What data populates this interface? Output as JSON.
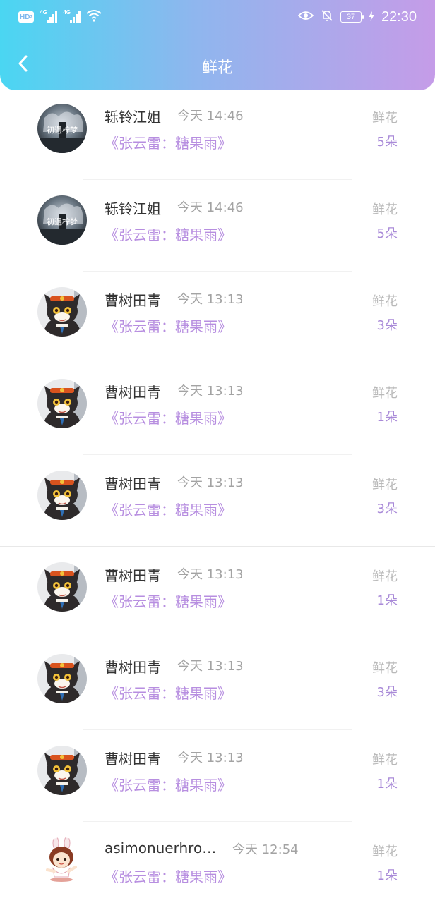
{
  "status_bar": {
    "hd_label": "HD",
    "hd_sub": "2",
    "network_1": "4G",
    "network_2": "4G",
    "battery": "37",
    "time": "22:30",
    "icons": [
      "wifi-icon",
      "eye-icon",
      "bell-off-icon",
      "charging-icon"
    ]
  },
  "header": {
    "title": "鲜花",
    "back_icon": "chevron-left-icon"
  },
  "colors": {
    "header_gradient_start": "#4ad6f2",
    "header_gradient_end": "#c59ce8",
    "song_color": "#b78ee0",
    "count_color": "#a98ad8"
  },
  "records": [
    {
      "name": "轹铃江姐",
      "time": "今天 14:46",
      "song": "《张云雷：糖果雨》",
      "kind": "鲜花",
      "count": "5朵",
      "avatar": "avatar-dark-logo"
    },
    {
      "name": "轹铃江姐",
      "time": "今天 14:46",
      "song": "《张云雷：糖果雨》",
      "kind": "鲜花",
      "count": "5朵",
      "avatar": "avatar-dark-logo"
    },
    {
      "name": "曹树田青",
      "time": "今天 13:13",
      "song": "《张云雷：糖果雨》",
      "kind": "鲜花",
      "count": "3朵",
      "avatar": "avatar-black-cat"
    },
    {
      "name": "曹树田青",
      "time": "今天 13:13",
      "song": "《张云雷：糖果雨》",
      "kind": "鲜花",
      "count": "1朵",
      "avatar": "avatar-black-cat"
    },
    {
      "name": "曹树田青",
      "time": "今天 13:13",
      "song": "《张云雷：糖果雨》",
      "kind": "鲜花",
      "count": "3朵",
      "avatar": "avatar-black-cat"
    },
    {
      "name": "曹树田青",
      "time": "今天 13:13",
      "song": "《张云雷：糖果雨》",
      "kind": "鲜花",
      "count": "1朵",
      "avatar": "avatar-black-cat"
    },
    {
      "name": "曹树田青",
      "time": "今天 13:13",
      "song": "《张云雷：糖果雨》",
      "kind": "鲜花",
      "count": "3朵",
      "avatar": "avatar-black-cat"
    },
    {
      "name": "曹树田青",
      "time": "今天 13:13",
      "song": "《张云雷：糖果雨》",
      "kind": "鲜花",
      "count": "1朵",
      "avatar": "avatar-black-cat"
    },
    {
      "name": "asimonuerhroc...",
      "time": "今天 12:54",
      "song": "《张云雷：糖果雨》",
      "kind": "鲜花",
      "count": "1朵",
      "avatar": "avatar-bunny-girl"
    }
  ]
}
